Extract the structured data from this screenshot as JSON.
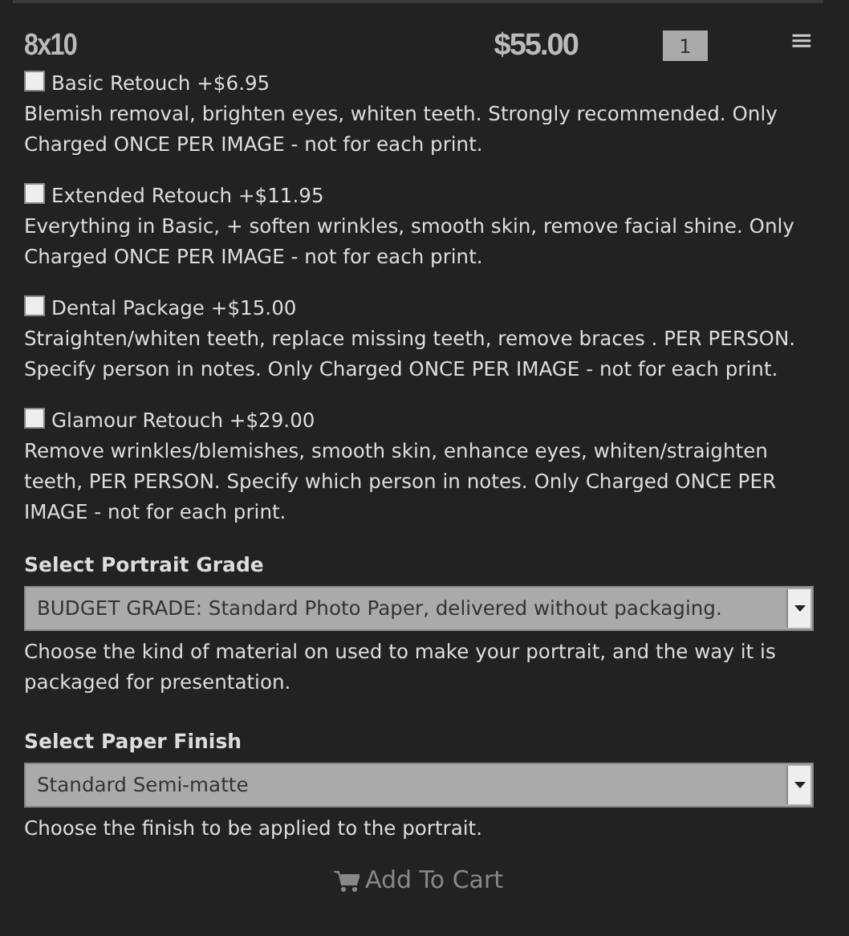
{
  "product": {
    "size": "8x10",
    "price": "$55.00",
    "quantity": "1",
    "menu_icon": "≡"
  },
  "options": [
    {
      "label": "Basic Retouch +$6.95",
      "checked": false,
      "description": "Blemish removal, brighten eyes, whiten teeth. Strongly recommended. Only Charged ONCE PER IMAGE - not for each print."
    },
    {
      "label": "Extended Retouch +$11.95",
      "checked": false,
      "description": "Everything in Basic, + soften wrinkles, smooth skin, remove facial shine. Only Charged ONCE PER IMAGE - not for each print."
    },
    {
      "label": "Dental Package +$15.00",
      "checked": false,
      "description": "Straighten/whiten teeth, replace missing teeth, remove braces . PER PERSON. Specify person in notes. Only Charged ONCE PER IMAGE - not for each print."
    },
    {
      "label": "Glamour Retouch +$29.00",
      "checked": false,
      "description": "Remove wrinkles/blemishes, smooth skin, enhance eyes, whiten/straighten teeth, PER PERSON. Specify which person in notes. Only Charged ONCE PER IMAGE - not for each print."
    }
  ],
  "selects": [
    {
      "label": "Select Portrait Grade",
      "value": "BUDGET GRADE: Standard Photo Paper, delivered without packaging.",
      "help": "Choose the kind of material on used to make your portrait, and the way it is packaged for presentation."
    },
    {
      "label": "Select Paper Finish",
      "value": "Standard Semi-matte",
      "help": "Choose the finish to be applied to the portrait."
    }
  ],
  "add_to_cart": "Add To Cart"
}
